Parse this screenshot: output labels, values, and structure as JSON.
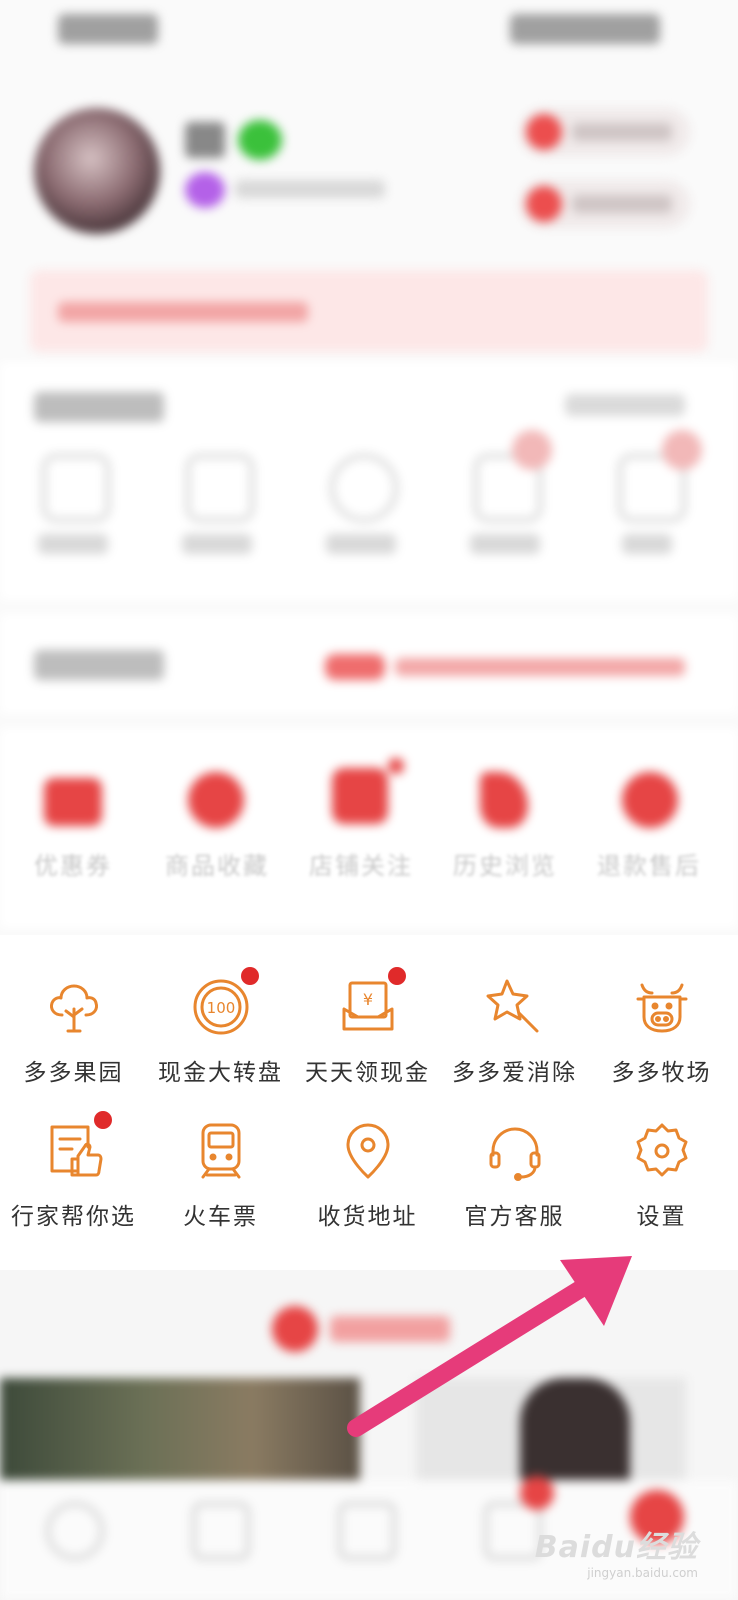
{
  "services": [
    {
      "label": "优惠券",
      "icon": "coupon-icon"
    },
    {
      "label": "商品收藏",
      "icon": "favorites-icon"
    },
    {
      "label": "店铺关注",
      "icon": "store-follow-icon"
    },
    {
      "label": "历史浏览",
      "icon": "history-icon"
    },
    {
      "label": "退款售后",
      "icon": "refund-icon"
    }
  ],
  "tools_row1": [
    {
      "label": "多多果园",
      "icon": "tree-icon",
      "dot": false
    },
    {
      "label": "现金大转盘",
      "icon": "coin-100-icon",
      "dot": true
    },
    {
      "label": "天天领现金",
      "icon": "yuan-envelope-icon",
      "dot": true
    },
    {
      "label": "多多爱消除",
      "icon": "magic-wand-star-icon",
      "dot": false
    },
    {
      "label": "多多牧场",
      "icon": "cow-icon",
      "dot": false
    }
  ],
  "tools_row2": [
    {
      "label": "行家帮你选",
      "icon": "thumbs-up-doc-icon",
      "dot": true
    },
    {
      "label": "火车票",
      "icon": "train-icon",
      "dot": false
    },
    {
      "label": "收货地址",
      "icon": "location-pin-icon",
      "dot": false
    },
    {
      "label": "官方客服",
      "icon": "headset-icon",
      "dot": false
    },
    {
      "label": "设置",
      "icon": "gear-icon",
      "dot": false
    }
  ],
  "watermark": {
    "brand": "Baidu经验",
    "url": "jingyan.baidu.com"
  },
  "colors": {
    "accent": "#e8862e",
    "badge": "#e02a2a",
    "arrow": "#e63b7a",
    "brand_red": "#e64545"
  }
}
